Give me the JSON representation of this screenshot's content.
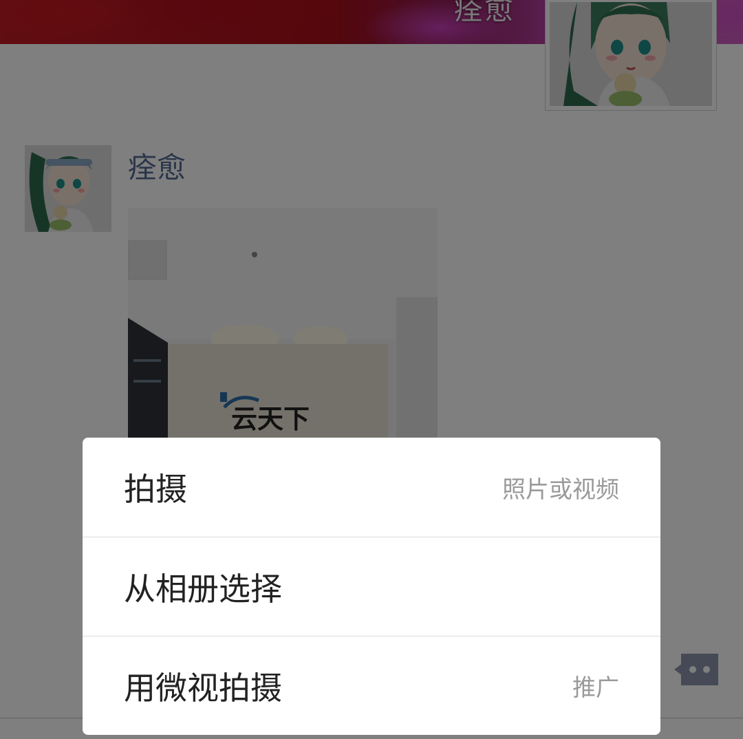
{
  "profile": {
    "cover_name": "痊愈"
  },
  "feed": {
    "post": {
      "author": "痊愈",
      "photo_sign_text": "云天下"
    }
  },
  "action_sheet": {
    "items": [
      {
        "label": "拍摄",
        "hint": "照片或视频"
      },
      {
        "label": "从相册选择",
        "hint": ""
      },
      {
        "label": "用微视拍摄",
        "hint": "推广"
      }
    ]
  },
  "colors": {
    "author_link": "#576b95",
    "overlay": "rgba(0,0,0,0.5)",
    "sheet_background": "#ffffff"
  },
  "icons": {
    "comment": "comment-dots-icon"
  }
}
